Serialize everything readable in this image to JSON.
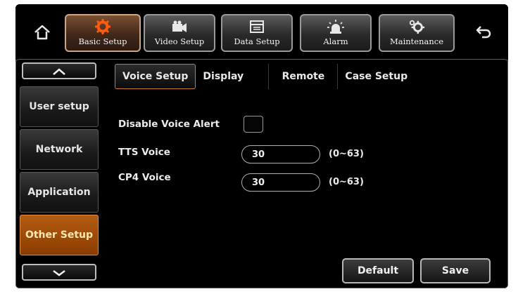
{
  "toolbar": {
    "items": [
      {
        "label": "Basic Setup",
        "icon": "gear-icon",
        "active": true
      },
      {
        "label": "Video Setup",
        "icon": "camera-icon",
        "active": false
      },
      {
        "label": "Data Setup",
        "icon": "document-icon",
        "active": false
      },
      {
        "label": "Alarm",
        "icon": "alarm-light-icon",
        "active": false
      },
      {
        "label": "Maintenance",
        "icon": "gears-icon",
        "active": false
      }
    ],
    "home_icon": "home-icon",
    "back_icon": "back-arrow-icon"
  },
  "sidebar": {
    "up_icon": "chevron-up-icon",
    "down_icon": "chevron-down-icon",
    "items": [
      {
        "label": "User setup",
        "active": false
      },
      {
        "label": "Network",
        "active": false
      },
      {
        "label": "Application",
        "active": false
      },
      {
        "label": "Other Setup",
        "active": true
      }
    ]
  },
  "tabs": [
    {
      "label": "Voice Setup",
      "active": true
    },
    {
      "label": "Display",
      "active": false
    },
    {
      "label": "Remote",
      "active": false
    },
    {
      "label": "Case Setup",
      "active": false
    }
  ],
  "form": {
    "disable_voice_alert": {
      "label": "Disable Voice Alert",
      "checked": false
    },
    "tts_voice": {
      "label": "TTS Voice",
      "value": "30",
      "range": "(0~63)"
    },
    "cp4_voice": {
      "label": "CP4 Voice",
      "value": "30",
      "range": "(0~63)"
    }
  },
  "buttons": {
    "default_label": "Default",
    "save_label": "Save"
  },
  "colors": {
    "accent": "#b45c12",
    "active_text": "#ffe9b0",
    "background": "#000000"
  }
}
